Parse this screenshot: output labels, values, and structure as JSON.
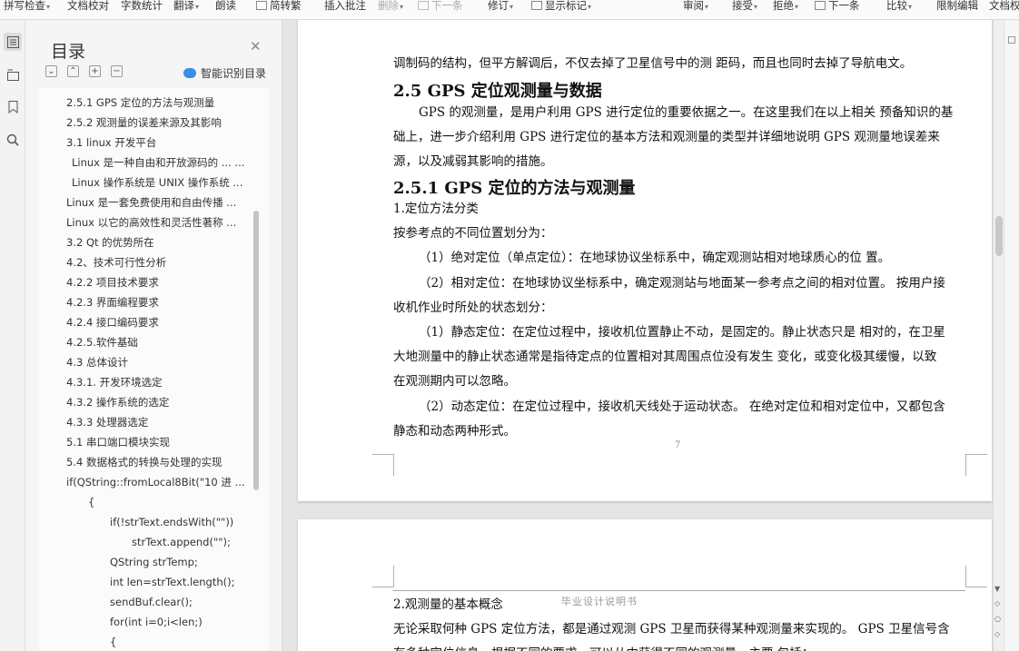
{
  "toolbar": {
    "items": [
      {
        "label": "拼写检查",
        "caret": true
      },
      {
        "label": "文档校对",
        "caret": false
      },
      {
        "label": "字数统计",
        "caret": false
      },
      {
        "label": "翻译",
        "caret": true
      },
      {
        "label": "朗读",
        "caret": false
      },
      {
        "label": "简转繁",
        "caret": false
      },
      {
        "label": "插入批注",
        "caret": false
      },
      {
        "label": "删除",
        "caret": true
      },
      {
        "label": "下一条",
        "caret": false
      },
      {
        "label": "修订",
        "caret": true
      },
      {
        "label": "显示标记",
        "caret": true
      },
      {
        "label": "审阅",
        "caret": true
      },
      {
        "label": "接受",
        "caret": true
      },
      {
        "label": "拒绝",
        "caret": true
      },
      {
        "label": "下一条",
        "caret": false
      },
      {
        "label": "比较",
        "caret": true
      },
      {
        "label": "限制编辑",
        "caret": false
      },
      {
        "label": "文档权",
        "caret": false
      }
    ]
  },
  "toc": {
    "title": "目录",
    "smart_label": "智能识别目录",
    "items": [
      "2.5.1 GPS  定位的方法与观测量",
      "2.5.2  观测量的误差来源及其影响",
      "3.1 linux 开发平台",
      "Linux 是一种自由和开放源码的 ... ...",
      "Linux 操作系统是 UNIX 操作系统 ...",
      "Linux 是一套免费使用和自由传播 ...",
      "Linux 以它的高效性和灵活性著称 ...",
      "3.2 Qt 的优势所在",
      "4.2、技术可行性分析",
      "4.2.2  项目技术要求",
      "4.2.3  界面编程要求",
      "4.2.4 接口编码要求",
      "4.2.5.软件基础",
      "4.3  总体设计",
      "4.3.1. 开发环境选定",
      "4.3.2 操作系统的选定",
      "4.3.3 处理器选定",
      "5.1 串口端口模块实现",
      "5.4 数据格式的转换与处理的实现",
      "if(QString::fromLocal8Bit(\"10 进 ...",
      "{",
      "if(!strText.endsWith(\"\"))",
      "strText.append(\"\");",
      "QString strTemp;",
      "int len=strText.length();",
      "sendBuf.clear();",
      "for(int i=0;i<len;)",
      "{"
    ]
  },
  "page1": {
    "line0": "调制码的结构，但平方解调后，不仅去掉了卫星信号中的测 距码，而且也同时去掉了导航电文。",
    "h_25": "2.5 GPS 定位观测量与数据",
    "p1a": "GPS 的观测量，是用户利用 GPS 进行定位的重要依据之一。在这里我们在以上相关 预备知识的基",
    "p1b": "础上，进一步介绍利用 GPS 进行定位的基本方法和观测量的类型并详细地说明 GPS 观测量地误差来",
    "p1c": "源，以及减弱其影响的措施。",
    "h_251": "2.5.1 GPS 定位的方法与观测量",
    "s1": "1.定位方法分类",
    "s2": "按参考点的不同位置划分为：",
    "s3": "（1）绝对定位（单点定位）：在地球协议坐标系中，确定观测站相对地球质心的位 置。",
    "s4a": "（2）相对定位：在地球协议坐标系中，确定观测站与地面某一参考点之间的相对位置。 按用户接",
    "s4b": "收机作业时所处的状态划分：",
    "s5a": "（1）静态定位：在定位过程中，接收机位置静止不动，是固定的。静止状态只是 相对的，在卫星",
    "s5b": "大地测量中的静止状态通常是指待定点的位置相对其周围点位没有发生 变化，或变化极其缓慢，以致",
    "s5c": "在观测期内可以忽略。",
    "s6a": "（2）动态定位：在定位过程中，接收机天线处于运动状态。 在绝对定位和相对定位中，又都包含",
    "s6b": "静态和动态两种形式。",
    "page_number": "7"
  },
  "page2": {
    "header": "毕业设计说明书",
    "t1": "2.观测量的基本概念",
    "t2": "无论采取何种 GPS 定位方法，都是通过观测 GPS 卫星而获得某种观测量来实现的。 GPS 卫星信号含",
    "t3": "有多种定位信息，根据不同的要求，可以从中获得不同的观测量，主要 包括："
  }
}
